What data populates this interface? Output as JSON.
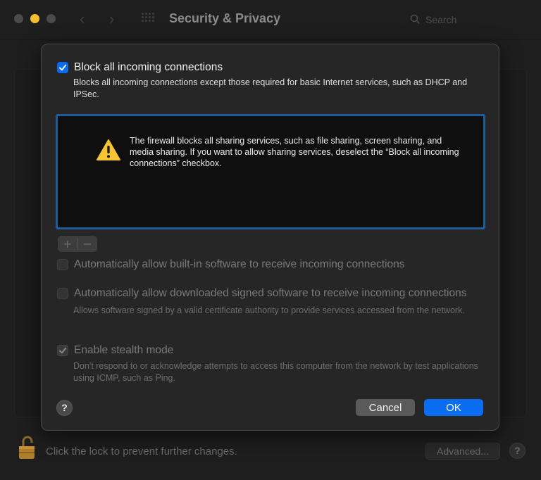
{
  "window": {
    "title": "Security & Privacy",
    "search_placeholder": "Search"
  },
  "footer": {
    "lock_text": "Click the lock to prevent further changes.",
    "advanced_label": "Advanced...",
    "help_label": "?"
  },
  "sheet": {
    "block_all": {
      "label": "Block all incoming connections",
      "checked": true,
      "description": "Blocks all incoming connections except those required for basic Internet services, such as DHCP and IPSec."
    },
    "warning": {
      "icon": "warning-icon",
      "text": "The firewall blocks all sharing services, such as file sharing, screen sharing, and media sharing. If you want to allow sharing services, deselect the “Block all incoming connections” checkbox."
    },
    "add_label": "+",
    "remove_label": "−",
    "allow_builtin": {
      "label": "Automatically allow built-in software to receive incoming connections",
      "checked": false
    },
    "allow_signed": {
      "label": "Automatically allow downloaded signed software to receive incoming connections",
      "checked": false,
      "description": "Allows software signed by a valid certificate authority to provide services accessed from the network."
    },
    "stealth": {
      "label": "Enable stealth mode",
      "checked": true,
      "description": "Don't respond to or acknowledge attempts to access this computer from the network by test applications using ICMP, such as Ping."
    },
    "help_label": "?",
    "cancel_label": "Cancel",
    "ok_label": "OK"
  },
  "colors": {
    "accent": "#0a6cf0",
    "list_border": "#1c5d99",
    "warning_yellow": "#f7c531"
  }
}
